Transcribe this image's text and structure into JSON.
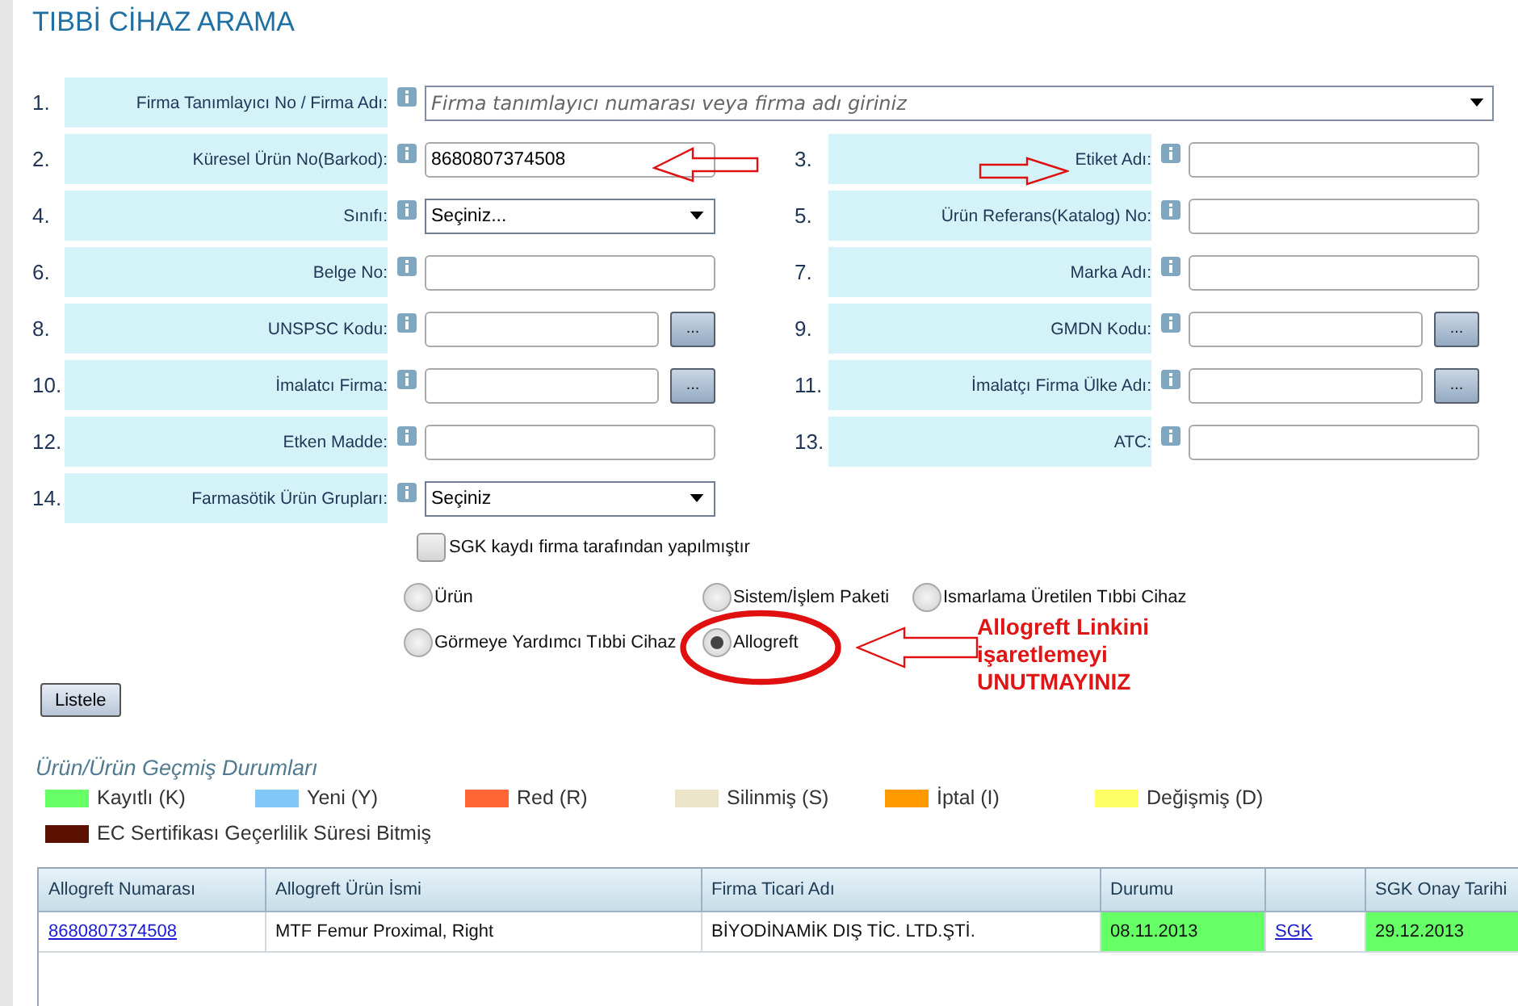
{
  "title": "TIBBİ CİHAZ ARAMA",
  "rows": [
    {
      "left": {
        "number": "1.",
        "label": "Firma Tanımlayıcı No / Firma Adı:",
        "kind": "combo",
        "placeholder": "Firma tanımlayıcı numarası veya firma adı giriniz"
      }
    },
    {
      "left": {
        "number": "2.",
        "label": "Küresel Ürün No(Barkod):",
        "kind": "text",
        "value": "8680807374508"
      },
      "right": {
        "number": "3.",
        "label": "Etiket Adı:",
        "kind": "text"
      }
    },
    {
      "left": {
        "number": "4.",
        "label": "Sınıfı:",
        "kind": "select",
        "value": "Seçiniz..."
      },
      "right": {
        "number": "5.",
        "label": "Ürün Referans(Katalog) No:",
        "kind": "text"
      }
    },
    {
      "left": {
        "number": "6.",
        "label": "Belge No:",
        "kind": "text"
      },
      "right": {
        "number": "7.",
        "label": "Marka Adı:",
        "kind": "text"
      }
    },
    {
      "left": {
        "number": "8.",
        "label": "UNSPSC Kodu:",
        "kind": "lookup",
        "button": "..."
      },
      "right": {
        "number": "9.",
        "label": "GMDN Kodu:",
        "kind": "lookup",
        "button": "..."
      }
    },
    {
      "left": {
        "number": "10.",
        "label": "İmalatcı Firma:",
        "kind": "lookup",
        "button": "..."
      },
      "right": {
        "number": "11.",
        "label": "İmalatçı Firma Ülke Adı:",
        "kind": "lookup",
        "button": "..."
      }
    },
    {
      "left": {
        "number": "12.",
        "label": "Etken Madde:",
        "kind": "text"
      },
      "right": {
        "number": "13.",
        "label": "ATC:",
        "kind": "text"
      }
    },
    {
      "left": {
        "number": "14.",
        "label": "Farmasötik Ürün Grupları:",
        "kind": "select",
        "value": "Seçiniz"
      }
    }
  ],
  "checkbox": {
    "label": "SGK kaydı firma tarafından yapılmıştır",
    "checked": false
  },
  "radios": [
    {
      "label": "Ürün",
      "selected": false
    },
    {
      "label": "Sistem/İşlem Paketi",
      "selected": false
    },
    {
      "label": "Ismarlama Üretilen Tıbbi Cihaz",
      "selected": false
    },
    {
      "label": "Görmeye Yardımcı Tıbbi Cihaz",
      "selected": false
    },
    {
      "label": "Allogreft",
      "selected": true
    }
  ],
  "annotation": {
    "lines": [
      "Allogreft Linkini",
      "işaretlemeyi",
      "UNUTMAYINIZ"
    ]
  },
  "list_button": "Listele",
  "legend": {
    "title": "Ürün/Ürün Geçmiş Durumları",
    "items": [
      {
        "label": "Kayıtlı (K)",
        "color": "#66ff66"
      },
      {
        "label": "Yeni (Y)",
        "color": "#80c8f8"
      },
      {
        "label": "Red (R)",
        "color": "#ff6633"
      },
      {
        "label": "Silinmiş (S)",
        "color": "#ece4c8"
      },
      {
        "label": "İptal (I)",
        "color": "#ff9900"
      },
      {
        "label": "Değişmiş (D)",
        "color": "#ffff66"
      },
      {
        "label": "EC Sertifikası Geçerlilik Süresi Bitmiş",
        "color": "#5c1000"
      }
    ]
  },
  "table": {
    "columns": [
      {
        "label": "Allogreft Numarası"
      },
      {
        "label": "Allogreft Ürün İsmi"
      },
      {
        "label": "Firma Ticari Adı"
      },
      {
        "label": "Durumu"
      },
      {},
      {
        "label": "SGK Onay Tarihi"
      }
    ],
    "rows": [
      {
        "cells": [
          {
            "kind": "link",
            "text": "8680807374508"
          },
          {
            "kind": "plain",
            "text": "MTF Femur Proximal, Right"
          },
          {
            "kind": "plain",
            "text": "BİYODİNAMİK DIŞ TİC. LTD.ŞTİ."
          },
          {
            "kind": "status",
            "text": "08.11.2013",
            "color": "#66ff66"
          },
          {
            "kind": "link",
            "text": "SGK"
          },
          {
            "kind": "status",
            "text": "29.12.2013",
            "color": "#66ff66"
          }
        ]
      }
    ]
  }
}
